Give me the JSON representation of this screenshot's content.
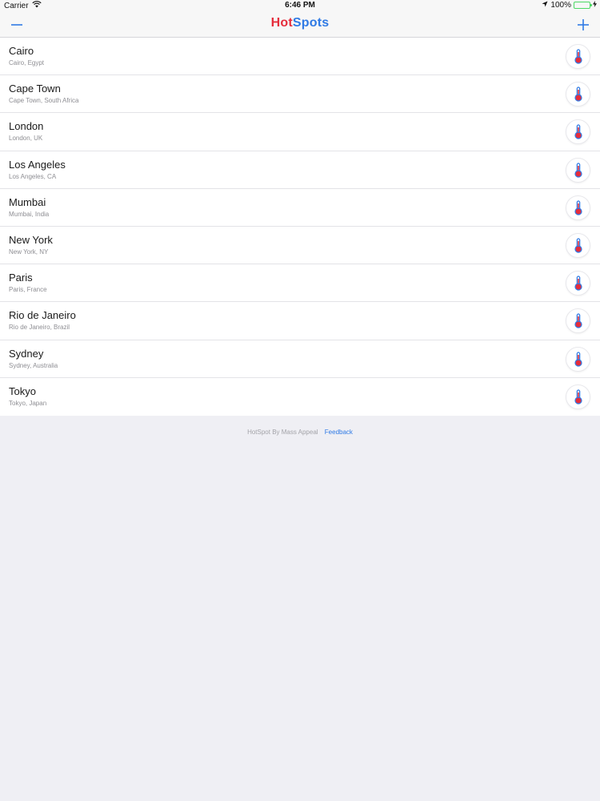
{
  "status_bar": {
    "carrier": "Carrier",
    "time": "6:46 PM",
    "battery": "100%"
  },
  "nav": {
    "title_part1": "Hot",
    "title_part2": "Spots"
  },
  "locations": [
    {
      "name": "Cairo",
      "detail": "Cairo, Egypt"
    },
    {
      "name": "Cape Town",
      "detail": "Cape Town, South Africa"
    },
    {
      "name": "London",
      "detail": "London, UK"
    },
    {
      "name": "Los Angeles",
      "detail": "Los Angeles, CA"
    },
    {
      "name": "Mumbai",
      "detail": "Mumbai, India"
    },
    {
      "name": "New York",
      "detail": "New York, NY"
    },
    {
      "name": "Paris",
      "detail": "Paris, France"
    },
    {
      "name": "Rio de Janeiro",
      "detail": "Rio de Janeiro, Brazil"
    },
    {
      "name": "Sydney",
      "detail": "Sydney, Australia"
    },
    {
      "name": "Tokyo",
      "detail": "Tokyo, Japan"
    }
  ],
  "footer": {
    "credit": "HotSpot By Mass Appeal",
    "link": "Feedback"
  },
  "colors": {
    "accent": "#2f7ae5",
    "hot": "#e52d3c",
    "background": "#efeff4"
  }
}
